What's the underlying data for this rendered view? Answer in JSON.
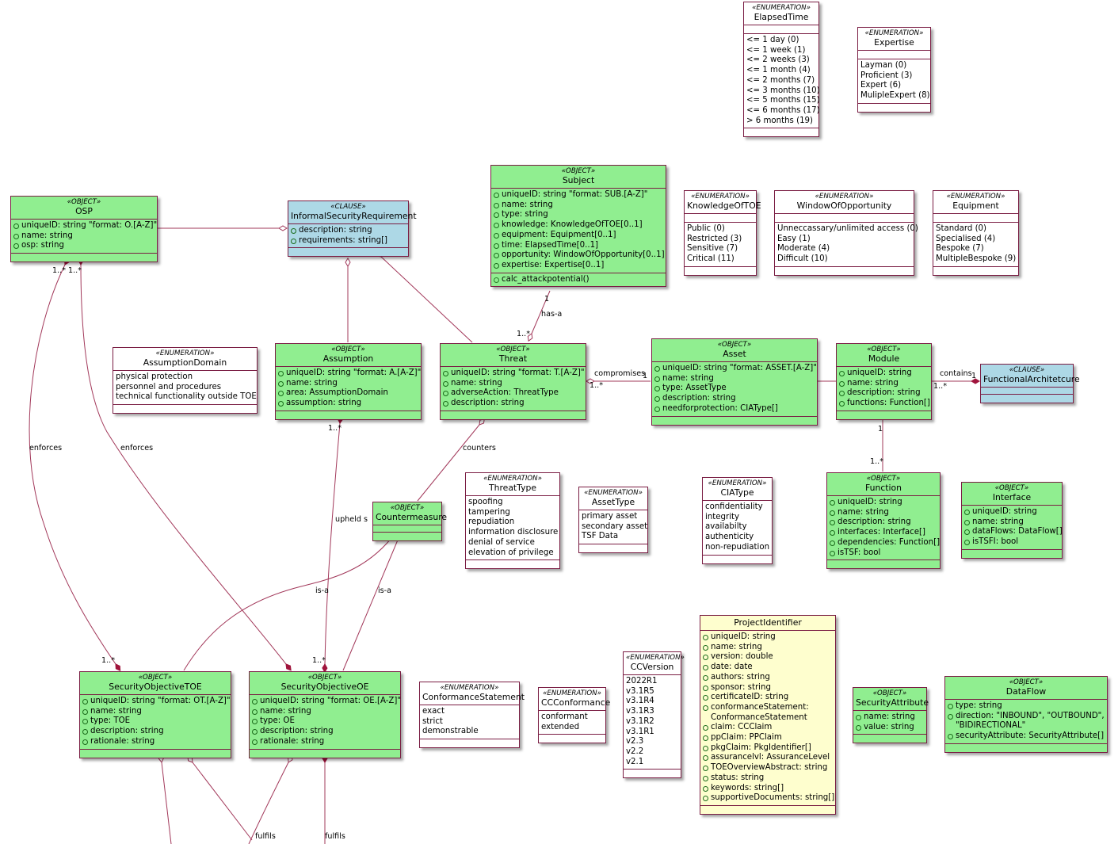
{
  "diagram": {
    "classes": {
      "elapsed_time": {
        "stereotype": "«ENUMERATION»",
        "name": "ElapsedTime",
        "values": [
          "<= 1 day (0)",
          "<= 1 week (1)",
          "<= 2 weeks (3)",
          "<= 1 month (4)",
          "<= 2 months (7)",
          "<= 3 months (10)",
          "<= 5 months (15)",
          "<= 6 months (17)",
          "> 6 months (19)"
        ]
      },
      "expertise": {
        "stereotype": "«ENUMERATION»",
        "name": "Expertise",
        "values": [
          "Layman (0)",
          "Proficient (3)",
          "Expert (6)",
          "MulipleExpert (8)"
        ]
      },
      "osp": {
        "stereotype": "«OBJECT»",
        "name": "OSP",
        "attributes": [
          "uniqueID: string \"format: O.[A-Z]\"",
          "name: string",
          "osp: string"
        ]
      },
      "informal_security_requirement": {
        "stereotype": "«CLAUSE»",
        "name": "InformalSecurityRequirement",
        "attributes": [
          "description: string",
          "requirements: string[]"
        ]
      },
      "subject": {
        "stereotype": "«OBJECT»",
        "name": "Subject",
        "attributes": [
          "uniqueID: string \"format: SUB.[A-Z]\"",
          "name: string",
          "type: string",
          "knowledge: KnowledgeOfTOE[0..1]",
          "equipment: Equipment[0..1]",
          "time: ElapsedTime[0..1]",
          "opportunity: WindowOfOpportunity[0..1]",
          "expertise: Expertise[0..1]"
        ],
        "methods": [
          "calc_attackpotential()"
        ]
      },
      "knowledge_of_toe": {
        "stereotype": "«ENUMERATION»",
        "name": "KnowledgeOfTOE",
        "values": [
          "Public (0)",
          "Restricted (3)",
          "Sensitive (7)",
          "Critical (11)"
        ]
      },
      "window_of_opportunity": {
        "stereotype": "«ENUMERATION»",
        "name": "WindowOfOpportunity",
        "values": [
          "Unneccassary/unlimited access (0)",
          "Easy (1)",
          "Moderate (4)",
          "Difficult (10)"
        ]
      },
      "equipment": {
        "stereotype": "«ENUMERATION»",
        "name": "Equipment",
        "values": [
          "Standard (0)",
          "Specialised (4)",
          "Bespoke (7)",
          "MultipleBespoke (9)"
        ]
      },
      "assumption_domain": {
        "stereotype": "«ENUMERATION»",
        "name": "AssumptionDomain",
        "values": [
          "physical protection",
          "personnel and procedures",
          "technical functionality outside TOE"
        ]
      },
      "assumption": {
        "stereotype": "«OBJECT»",
        "name": "Assumption",
        "attributes": [
          "uniqueID: string \"format: A.[A-Z]\"",
          "name: string",
          "area: AssumptionDomain",
          "assumption: string"
        ]
      },
      "threat": {
        "stereotype": "«OBJECT»",
        "name": "Threat",
        "attributes": [
          "uniqueID: string \"format: T.[A-Z]\"",
          "name: string",
          "adverseAction: ThreatType",
          "description: string"
        ]
      },
      "asset": {
        "stereotype": "«OBJECT»",
        "name": "Asset",
        "attributes": [
          "uniqueID: string \"format: ASSET.[A-Z]\"",
          "name: string",
          "type: AssetType",
          "description: string",
          "needforprotection: CIAType[]"
        ]
      },
      "module": {
        "stereotype": "«OBJECT»",
        "name": "Module",
        "attributes": [
          "uniqueID: string",
          "name: string",
          "description: string",
          "functions: Function[]"
        ]
      },
      "functional_architecture": {
        "stereotype": "«CLAUSE»",
        "name": "FunctionalArchitetcure"
      },
      "countermeasure": {
        "stereotype": "«OBJECT»",
        "name": "Countermeasure"
      },
      "threat_type": {
        "stereotype": "«ENUMERATION»",
        "name": "ThreatType",
        "values": [
          "spoofing",
          "tampering",
          "repudiation",
          "information disclosure",
          "denial of service",
          "elevation of privilege"
        ]
      },
      "asset_type": {
        "stereotype": "«ENUMERATION»",
        "name": "AssetType",
        "values": [
          "primary asset",
          "secondary asset",
          "TSF Data"
        ]
      },
      "cia_type": {
        "stereotype": "«ENUMERATION»",
        "name": "CIAType",
        "values": [
          "confidentiality",
          "integrity",
          "availabilty",
          "authenticity",
          "non-repudiation"
        ]
      },
      "function": {
        "stereotype": "«OBJECT»",
        "name": "Function",
        "attributes": [
          "uniqueID: string",
          "name: string",
          "description: string",
          "interfaces: Interface[]",
          "dependencies: Function[]",
          "isTSF: bool"
        ]
      },
      "interface": {
        "stereotype": "«OBJECT»",
        "name": "Interface",
        "attributes": [
          "uniqueID: string",
          "name: string",
          "dataFlows: DataFlow[]",
          "isTSFI: bool"
        ]
      },
      "security_objective_toe": {
        "stereotype": "«OBJECT»",
        "name": "SecurityObjectiveTOE",
        "attributes": [
          "uniqueID: string \"format: OT.[A-Z]\"",
          "name: string",
          "type: TOE",
          "description: string",
          "rationale: string"
        ]
      },
      "security_objective_oe": {
        "stereotype": "«OBJECT»",
        "name": "SecurityObjectiveOE",
        "attributes": [
          "uniqueID: string \"format: OE.[A-Z]\"",
          "name: string",
          "type: OE",
          "description: string",
          "rationale: string"
        ]
      },
      "conformance_statement": {
        "stereotype": "«ENUMERATION»",
        "name": "ConformanceStatement",
        "values": [
          "exact",
          "strict",
          "demonstrable"
        ]
      },
      "cc_conformance": {
        "stereotype": "«ENUMERATION»",
        "name": "CCConformance",
        "values": [
          "conformant",
          "extended"
        ]
      },
      "cc_version": {
        "stereotype": "«ENUMERATION»",
        "name": "CCVersion",
        "values": [
          "2022R1",
          "v3.1R5",
          "v3.1R4",
          "v3.1R3",
          "v3.1R2",
          "v3.1R1",
          "v2.3",
          "v2.2",
          "v2.1"
        ]
      },
      "project_identifier": {
        "name": "ProjectIdentifier",
        "attributes": [
          "uniqueID: string",
          "name: string",
          "version: double",
          "date: date",
          "authors: string",
          "sponsor: string",
          "certificateID: string",
          "conformanceStatement:\nConformanceStatement",
          "claim: CCClaim",
          "ppClaim: PPClaim",
          "pkgClaim: PkgIdentifier[]",
          "assurancelvl: AssuranceLevel",
          "TOEOverviewAbstract: string",
          "status: string",
          "keywords: string[]",
          "supportiveDocuments: string[]"
        ]
      },
      "security_attribute": {
        "stereotype": "«OBJECT»",
        "name": "SecurityAttribute",
        "attributes": [
          "name: string",
          "value: string"
        ]
      },
      "data_flow": {
        "stereotype": "«OBJECT»",
        "name": "DataFlow",
        "attributes": [
          "type: string",
          "direction: \"INBOUND\", \"OUTBOUND\",\n\"BIDIRECTIONAL\"",
          "securityAttribute: SecurityAttribute[]"
        ]
      }
    },
    "labels": {
      "enforces_toe": "enforces",
      "enforces_oe": "enforces",
      "osp_mult_1": "1..*",
      "osp_mult_2": "1..*",
      "sotoe_mult": "1..*",
      "sooe_mult": "1..*",
      "has_a": "has-a",
      "subject_mult": "1",
      "threat_mult_top": "1..*",
      "compromises": "compromises",
      "compromises_asset_mult": "1",
      "compromises_threat_mult": "1..*",
      "contains": "contains",
      "contains_fa_mult": "1",
      "contains_module_mult": "1..*",
      "module_fn_mult": "1",
      "function_mult": "1..*",
      "counters": "counters",
      "upholds": "upheld s",
      "assumption_mult": "1..*",
      "is_a_1": "is-a",
      "is_a_2": "is-a",
      "fulfils_1": "fulfils",
      "fulfils_2": "fulfils"
    },
    "colors": {
      "object_fill": "#90ee90",
      "clause_fill": "#add8e6",
      "enum_fill": "#ffffff",
      "project_fill": "#fefece",
      "border": "#7a1d43",
      "line": "#a2385a"
    }
  }
}
